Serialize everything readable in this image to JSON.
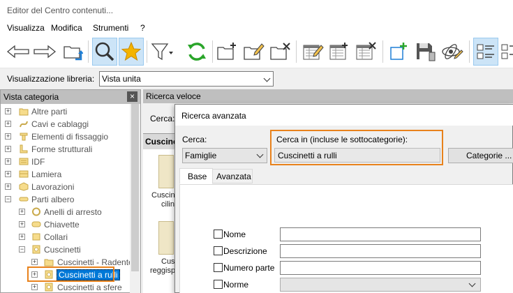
{
  "window": {
    "title": "Editor del Centro contenuti..."
  },
  "menu": [
    "Visualizza",
    "Modifica",
    "Strumenti",
    "?"
  ],
  "toolbar": {
    "icons": [
      "back-arrow-icon",
      "forward-arrow-icon",
      "folder-up-icon",
      "search-icon",
      "favorites-star-icon",
      "filter-icon",
      "refresh-icon",
      "new-category-icon",
      "edit-category-icon",
      "delete-category-icon",
      "new-family-icon",
      "edit-family-icon",
      "delete-family-icon",
      "add-family-icon",
      "save-icon",
      "publish-icon",
      "list-view-icon"
    ]
  },
  "library_view": {
    "label": "Visualizzazione libreria:",
    "value": "Vista unita"
  },
  "category_panel": {
    "title": "Vista categoria",
    "close": "×",
    "items": [
      {
        "label": "Altre parti",
        "level": 0
      },
      {
        "label": "Cavi e cablaggi",
        "level": 0
      },
      {
        "label": "Elementi di fissaggio",
        "level": 0
      },
      {
        "label": "Forme strutturali",
        "level": 0
      },
      {
        "label": "IDF",
        "level": 0
      },
      {
        "label": "Lamiera",
        "level": 0
      },
      {
        "label": "Lavorazioni",
        "level": 0
      },
      {
        "label": "Parti albero",
        "level": 0
      },
      {
        "label": "Anelli di arresto",
        "level": 1
      },
      {
        "label": "Chiavette",
        "level": 1
      },
      {
        "label": "Collari",
        "level": 1
      },
      {
        "label": "Cuscinetti",
        "level": 1
      },
      {
        "label": "Cuscinetti - Radente",
        "level": 2
      },
      {
        "label": "Cuscinetti a rulli",
        "level": 2,
        "selected": true
      },
      {
        "label": "Cuscinetti a sfere",
        "level": 2
      }
    ]
  },
  "quick_search": {
    "title": "Ricerca veloce",
    "search_label": "Cerca:",
    "results_header": "Cuscine",
    "results": [
      {
        "line1": "Cuscine",
        "line2": "cilin"
      },
      {
        "line1": "Cus",
        "line2": "reggisp"
      }
    ]
  },
  "advanced_search": {
    "title": "Ricerca avanzata",
    "search_label": "Cerca:",
    "search_value": "Famiglie",
    "search_in_label": "Cerca in (incluse le sottocategorie):",
    "search_in_value": "Cuscinetti a rulli",
    "categories_button": "Categorie ...",
    "tabs": [
      "Base",
      "Avanzata"
    ],
    "active_tab": "Base",
    "fields": [
      "Nome",
      "Descrizione",
      "Numero parte",
      "Norme"
    ]
  },
  "colors": {
    "highlight": "#e8821c",
    "selection": "#0078d7"
  }
}
